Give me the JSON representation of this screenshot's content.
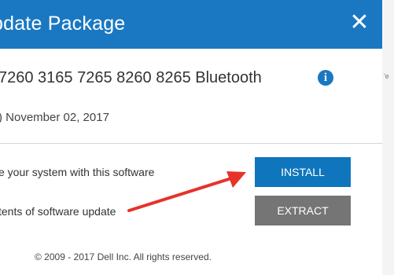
{
  "dialog": {
    "title": "pdate Package",
    "close_glyph": "✕",
    "product_line": "7260 3165 7265 8260 8265 Bluetooth",
    "info_glyph": "i",
    "date_line": ") November 02, 2017",
    "install_row_label": "e your system with this software",
    "extract_row_label": "tents of software update",
    "install_label": "INSTALL",
    "extract_label": "EXTRACT",
    "copyright": "© 2009 - 2017 Dell Inc. All rights reserved."
  },
  "background": {
    "side_text": "'e"
  },
  "annotation": {
    "arrow_color": "#e5332a"
  },
  "colors": {
    "titlebar": "#1a78c2",
    "install_button": "#0f76bd",
    "extract_button": "#757575"
  }
}
